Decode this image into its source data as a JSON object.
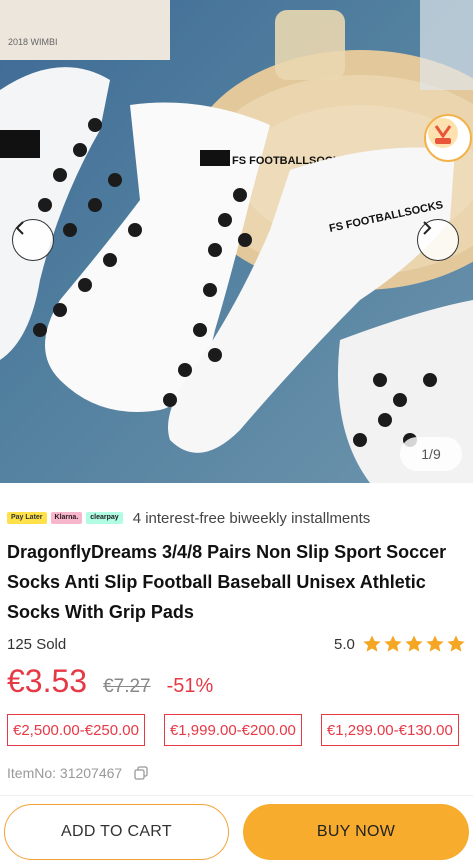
{
  "gallery": {
    "counter": "1/9",
    "prev_icon": "chevron-left-icon",
    "next_icon": "chevron-right-icon",
    "badge_icon": "promo-badge-icon",
    "image_subject": "white grip football socks",
    "image_print_1": "FS FOOTBALLSOCKS",
    "image_print_2": "FS FOOTBALLSOCKS"
  },
  "payment": {
    "logos": [
      "Pay Later",
      "Klarna.",
      "clearpay"
    ],
    "text": "4 interest-free biweekly installments"
  },
  "product": {
    "title": "DragonflyDreams 3/4/8 Pairs Non Slip Sport Soccer Socks Anti Slip Football Baseball Unisex Athletic Socks With Grip Pads",
    "sold": "125 Sold",
    "rating": "5.0",
    "stars": 5,
    "price": "€3.53",
    "old_price": "€7.27",
    "discount": "-51%",
    "tiers": [
      "€2,500.00-€250.00",
      "€1,999.00-€200.00",
      "€1,299.00-€130.00"
    ],
    "item_no": "ItemNo: 31207467",
    "copy_icon": "copy-icon"
  },
  "actions": {
    "add_to_cart": "ADD TO CART",
    "buy_now": "BUY NOW"
  },
  "colors": {
    "accent": "#e63946",
    "buy_button": "#f7ac2e",
    "star": "#f5a623"
  }
}
